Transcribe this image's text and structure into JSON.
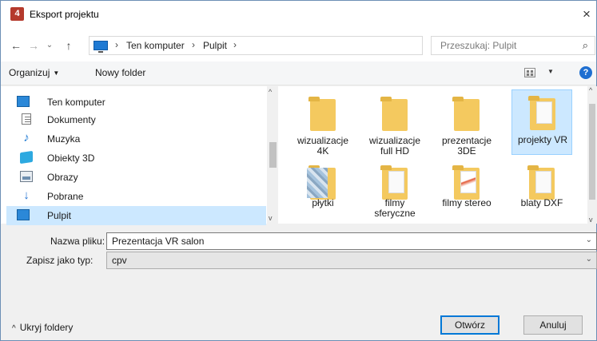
{
  "window": {
    "title": "Eksport projektu",
    "app_icon_glyph": "4",
    "close_glyph": "×"
  },
  "nav": {
    "back_glyph": "←",
    "forward_glyph": "→",
    "recent_glyph": "⌄",
    "up_glyph": "↑",
    "breadcrumb": [
      "Ten komputer",
      "Pulpit"
    ],
    "sep_glyph": "›",
    "dropdown_glyph": "⌄",
    "refresh_glyph": "↻",
    "search_placeholder": "Przeszukaj: Pulpit",
    "search_glyph": "⌕"
  },
  "toolbar": {
    "organize_label": "Organizuj",
    "organize_caret": "▼",
    "new_folder_label": "Nowy folder",
    "view_caret": "▼",
    "help_glyph": "?"
  },
  "tree": {
    "items": [
      {
        "label": "Ten komputer",
        "icon": "computer-icon"
      },
      {
        "label": "Dokumenty",
        "icon": "documents-icon"
      },
      {
        "label": "Muzyka",
        "icon": "music-icon"
      },
      {
        "label": "Obiekty 3D",
        "icon": "objects-3d-icon"
      },
      {
        "label": "Obrazy",
        "icon": "pictures-icon"
      },
      {
        "label": "Pobrane",
        "icon": "downloads-icon"
      },
      {
        "label": "Pulpit",
        "icon": "desktop-icon",
        "selected": true
      }
    ],
    "music_glyph": "♪",
    "download_glyph": "↓",
    "scroll_up": "^",
    "scroll_down": "v"
  },
  "files": [
    {
      "label": "wizualizacje 4K",
      "style": "plain"
    },
    {
      "label": "wizualizacje full HD",
      "style": "plain"
    },
    {
      "label": "prezentacje 3DE",
      "style": "plain"
    },
    {
      "label": "projekty VR",
      "style": "doc",
      "selected": true
    },
    {
      "label": "płytki",
      "style": "stripes"
    },
    {
      "label": "filmy sferyczne",
      "style": "doc"
    },
    {
      "label": "filmy stereo",
      "style": "red"
    },
    {
      "label": "blaty DXF",
      "style": "doc"
    }
  ],
  "form": {
    "filename_label": "Nazwa pliku:",
    "filename_value": "Prezentacja VR salon",
    "type_label": "Zapisz jako typ:",
    "type_value": "cpv",
    "dropdown_glyph": "⌄"
  },
  "footer": {
    "hide_folders_label": "Ukryj foldery",
    "hide_folders_caret": "^",
    "open_label": "Otwórz",
    "cancel_label": "Anuluj"
  },
  "colors": {
    "selection": "#cce8ff",
    "accent": "#0078d7",
    "folder": "#f4c95f"
  }
}
